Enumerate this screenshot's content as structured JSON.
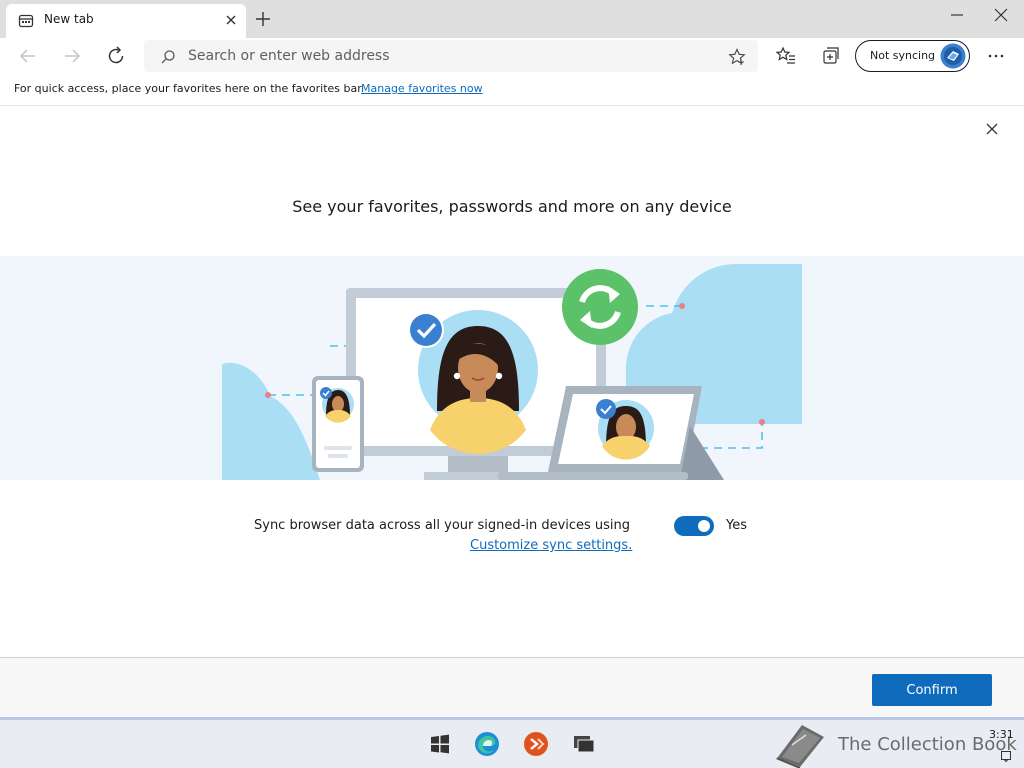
{
  "browser": {
    "tab": {
      "title": "New tab",
      "favicon": "new-tab-page-icon"
    },
    "address_bar": {
      "placeholder": "Search or enter web address"
    },
    "profile": {
      "label": "Not syncing"
    },
    "favorites_bar": {
      "text": "For quick access, place your favorites here on the favorites bar.",
      "link": "Manage favorites now"
    },
    "icons": [
      "back-arrow-icon",
      "forward-arrow-icon",
      "refresh-icon",
      "search-icon",
      "star-icon",
      "favorites-icon",
      "collections-icon",
      "more-icon",
      "close-icon",
      "plus-icon",
      "minimize-icon"
    ]
  },
  "dialog": {
    "heading": "See your favorites, passwords and more on any device",
    "sync_text": "Sync browser data across all your signed-in devices using",
    "sync_link": "Customize sync settings.",
    "toggle_label": "Yes",
    "toggle_on": true,
    "confirm_label": "Confirm"
  },
  "taskbar": {
    "apps": [
      "windows-start-icon",
      "edge-icon",
      "remote-app-icon",
      "task-view-icon"
    ],
    "clock": "3:31",
    "watermark": "The Collection Book"
  },
  "colors": {
    "accent": "#0f6cbd",
    "sync_green": "#5cc26a",
    "cloud_blue": "#a9def5",
    "skin": "#c98a5a",
    "shirt": "#f7d16b"
  }
}
